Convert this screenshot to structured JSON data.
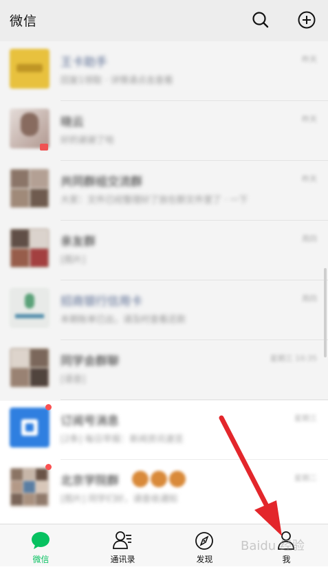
{
  "header": {
    "title": "微信",
    "search_icon": "search-icon",
    "add_icon": "plus-circle-icon"
  },
  "chats": [
    {
      "name": "王卡助手",
      "preview": "回复1领取 · 详情请点击查看",
      "time": "昨天",
      "name_color": "#576b95",
      "avatar_color": "#f2c83a"
    },
    {
      "name": "晓云",
      "preview": "好的谢谢了哈",
      "time": "昨天",
      "name_color": "#222222",
      "avatar_color": "#d9c4bd"
    },
    {
      "name": "共同群组交流群",
      "preview": "大家：文件已经整理好了放在群文件里了 · 一下",
      "time": "昨天",
      "name_color": "#222222",
      "avatar_color": "#a89a8e"
    },
    {
      "name": "亲友群",
      "preview": "[图片]",
      "time": "周四",
      "name_color": "#222222",
      "avatar_color": "#7d6a60"
    },
    {
      "name": "招商银行信用卡",
      "preview": "本期账单已出，请及时查看还款",
      "time": "周四",
      "name_color": "#576b95",
      "avatar_color": "#e8efe9"
    },
    {
      "name": "同学会群聊",
      "preview": "[语音]",
      "time": "星期三 10:35",
      "name_color": "#222222",
      "avatar_color": "#9c8a7c"
    },
    {
      "name": "订阅号消息",
      "preview": "[2条] 每日早报：新闻资讯速览",
      "time": "星期三",
      "name_color": "#222222",
      "avatar_color": "#2f7fe0"
    },
    {
      "name": "北京学院群",
      "preview": "[图片] 同学们好，请查收通知",
      "time": "星期二",
      "name_color": "#222222",
      "avatar_color": "#b7a596"
    }
  ],
  "tabs": [
    {
      "label": "微信",
      "icon": "chat-bubble-icon"
    },
    {
      "label": "通讯录",
      "icon": "contacts-icon"
    },
    {
      "label": "发现",
      "icon": "compass-icon"
    },
    {
      "label": "我",
      "icon": "person-icon"
    }
  ],
  "watermark": "Baidu 经验",
  "colors": {
    "accent": "#07c160",
    "badge": "#fa5151",
    "annotation_arrow": "#e3262b"
  }
}
